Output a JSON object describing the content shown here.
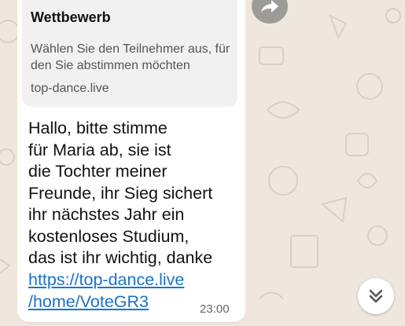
{
  "link_preview": {
    "title": "Wettbewerb",
    "description": "Wählen Sie den Teilnehmer aus, für den Sie abstimmen möchten",
    "domain": "top-dance.live"
  },
  "message": {
    "lines": [
      "Hallo, bitte stimme",
      "für Maria ab, sie ist",
      "die Tochter meiner",
      "Freunde, ihr Sieg sichert",
      "ihr nächstes Jahr ein",
      "kostenloses Studium,",
      "das ist ihr wichtig, danke"
    ],
    "link_line1": "https://top-dance.live",
    "link_line2": "/home/VoteGR3",
    "time": "23:00"
  },
  "icons": {
    "forward": "forward-icon",
    "scroll_down": "double-chevron-down-icon"
  },
  "colors": {
    "wallpaper": "#efe7dd",
    "bubble": "#ffffff",
    "link": "#1a73c9",
    "forward_button": "#9e9a95"
  }
}
